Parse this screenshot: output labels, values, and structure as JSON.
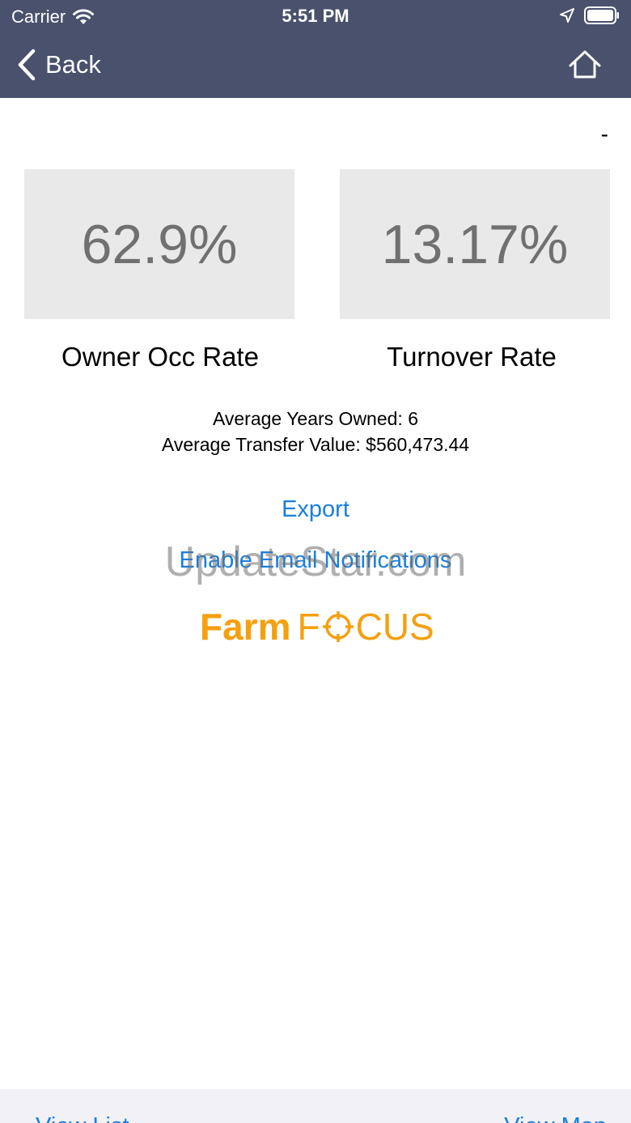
{
  "status_bar": {
    "carrier": "Carrier",
    "time": "5:51 PM",
    "icons": [
      "wifi-icon",
      "location-icon",
      "battery-icon"
    ]
  },
  "nav": {
    "back_label": "Back",
    "icons": [
      "chevron-left-icon",
      "home-icon"
    ]
  },
  "header_dash": "-",
  "stats": {
    "owner_occ_value": "62.9%",
    "owner_occ_label": "Owner Occ Rate",
    "turnover_value": "13.17%",
    "turnover_label": "Turnover Rate"
  },
  "summary": {
    "avg_years_owned": "Average Years Owned: 6",
    "avg_transfer_value": "Average Transfer Value: $560,473.44"
  },
  "actions": {
    "export_label": "Export",
    "notify_label": "Enable Email Notifications"
  },
  "logo": {
    "farm": "Farm",
    "focus_f": "F",
    "focus_rest": "CUS"
  },
  "watermark": "UpdateStar.com",
  "bottom": {
    "left_label": "View List",
    "right_label": "View Map"
  },
  "colors": {
    "header_bg": "#49516c",
    "link": "#1a7fe0",
    "logo": "#f5a00f",
    "stat_box_bg": "#e9e9e9",
    "stat_value": "#707070"
  }
}
